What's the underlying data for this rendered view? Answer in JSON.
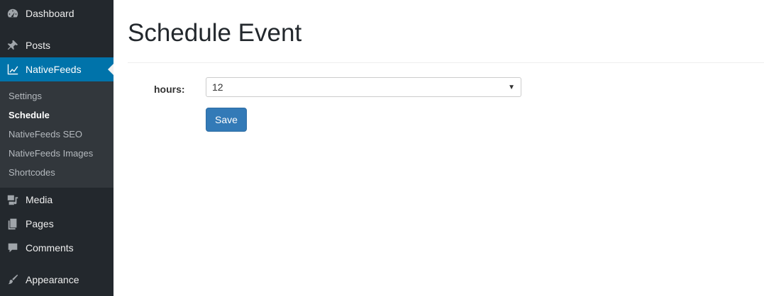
{
  "sidebar": {
    "items": [
      {
        "label": "Dashboard",
        "icon": "dashboard-icon"
      },
      {
        "label": "Posts",
        "icon": "pin-icon"
      },
      {
        "label": "NativeFeeds",
        "icon": "chart-line-icon"
      },
      {
        "label": "Media",
        "icon": "media-icon"
      },
      {
        "label": "Pages",
        "icon": "pages-icon"
      },
      {
        "label": "Comments",
        "icon": "comment-icon"
      },
      {
        "label": "Appearance",
        "icon": "paintbrush-icon"
      }
    ],
    "submenu": [
      {
        "label": "Settings"
      },
      {
        "label": "Schedule"
      },
      {
        "label": "NativeFeeds SEO"
      },
      {
        "label": "NativeFeeds Images"
      },
      {
        "label": "Shortcodes"
      }
    ]
  },
  "main": {
    "title": "Schedule Event",
    "form": {
      "hours_label": "hours:",
      "hours_value": "12",
      "save_label": "Save"
    }
  },
  "colors": {
    "sidebar_bg": "#23282d",
    "submenu_bg": "#32373c",
    "active_bg": "#0073aa",
    "button_bg": "#337ab7"
  }
}
